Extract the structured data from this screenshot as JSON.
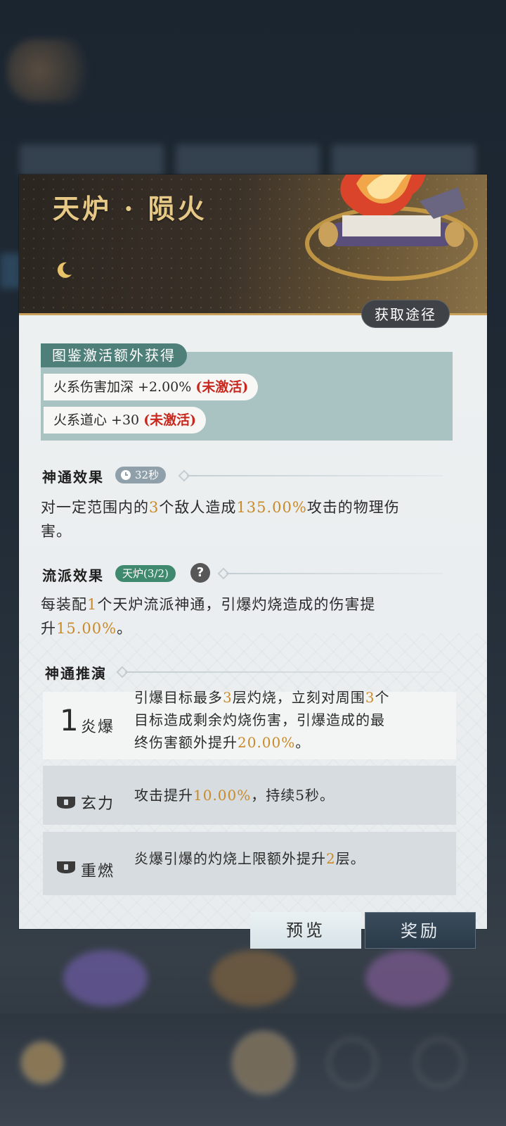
{
  "card": {
    "title": "天炉 · 陨火",
    "obtain_button": "获取途径"
  },
  "codex": {
    "tag": "图鉴激活额外获得",
    "lines": [
      {
        "text": "火系伤害加深 +2.00% ",
        "status": "(未激活)"
      },
      {
        "text": "火系道心 +30 ",
        "status": "(未激活)"
      }
    ]
  },
  "skill": {
    "title": "神通效果",
    "cooldown": "32秒",
    "desc_a": "对一定范围内的",
    "desc_n1": "3",
    "desc_b": "个敌人造成",
    "desc_n2": "135.00%",
    "desc_c": "攻击的物理伤",
    "desc_d": "害。"
  },
  "school": {
    "title": "流派效果",
    "badge": "天炉(3/2)",
    "help": "?",
    "desc_a": "每装配",
    "desc_n1": "1",
    "desc_b": "个天炉流派神通，引爆灼烧造成的伤害提",
    "desc_c": "升",
    "desc_n2": "15.00%",
    "desc_d": "。"
  },
  "evolution": {
    "title": "神通推演",
    "rows": [
      {
        "num": "1",
        "name": "炎爆",
        "line1a": "引爆目标最多",
        "line1n": "3",
        "line1b": "层灼烧，立刻对周围",
        "line1n2": "3",
        "line1c": "个",
        "line2": "目标造成剩余灼烧伤害，引爆造成的最",
        "line3a": "终伤害额外提升",
        "line3n": "20.00%",
        "line3b": "。"
      },
      {
        "name": "玄力",
        "texta": "攻击提升",
        "textn": "10.00%",
        "textb": "，持续5秒。",
        "icon": "lock-icon"
      },
      {
        "name": "重燃",
        "texta": "炎爆引爆的灼烧上限额外提升",
        "textn": "2",
        "textb": "层。",
        "icon": "lock-icon"
      }
    ]
  },
  "buttons": {
    "preview": "预览",
    "reward": "奖励"
  },
  "colors": {
    "accent_gold": "#e6c887",
    "highlight": "#c98a2a",
    "inactive_red": "#c8281e",
    "codex_teal": "#4f7f79"
  }
}
